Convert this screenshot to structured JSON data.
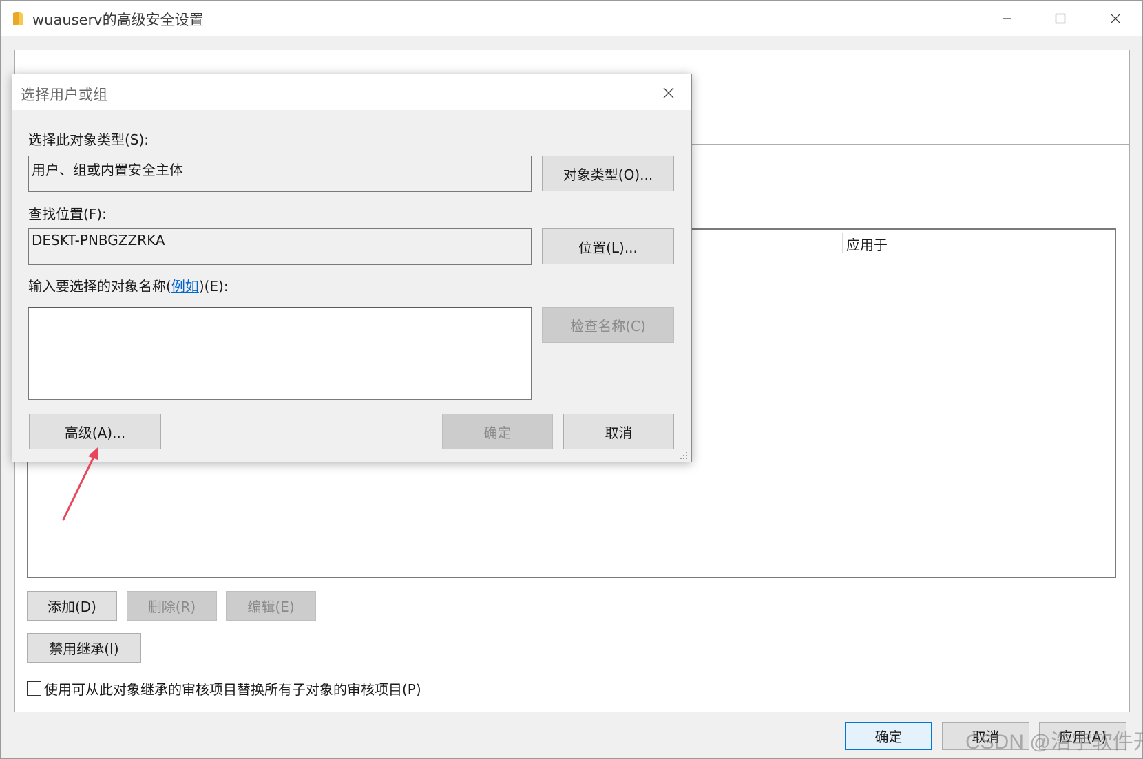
{
  "main_window": {
    "title": "wuauserv的高级安全设置",
    "icon": "folder-icon",
    "controls": [
      "minimize-icon",
      "maximize-icon",
      "close-icon"
    ]
  },
  "entries": {
    "column_applies_to": "应用于"
  },
  "actions": {
    "add": "添加(D)",
    "remove": "删除(R)",
    "edit": "编辑(E)",
    "disable_inheritance": "禁用继承(I)"
  },
  "replace_option": {
    "label": "使用可从此对象继承的审核项目替换所有子对象的审核项目(P)",
    "checked": false
  },
  "footer": {
    "ok": "确定",
    "cancel": "取消",
    "apply": "应用(A)"
  },
  "dialog": {
    "title": "选择用户或组",
    "object_type_label": "选择此对象类型(S):",
    "object_type_value": "用户、组或内置安全主体",
    "object_types_button": "对象类型(O)...",
    "location_label": "查找位置(F):",
    "location_value": "DESKT-PNBGZZRKA",
    "locations_button": "位置(L)...",
    "enter_names_prefix": "输入要选择的对象名称(",
    "example_link": "例如",
    "enter_names_suffix": ")(E):",
    "names_value": "",
    "check_names_button": "检查名称(C)",
    "advanced_button": "高级(A)...",
    "ok_button": "确定",
    "cancel_button": "取消"
  },
  "watermark": "CSDN @浩宇软件开发",
  "colors": {
    "accent": "#0078d7",
    "link": "#0066cc",
    "annotation_arrow": "#e8465a"
  }
}
